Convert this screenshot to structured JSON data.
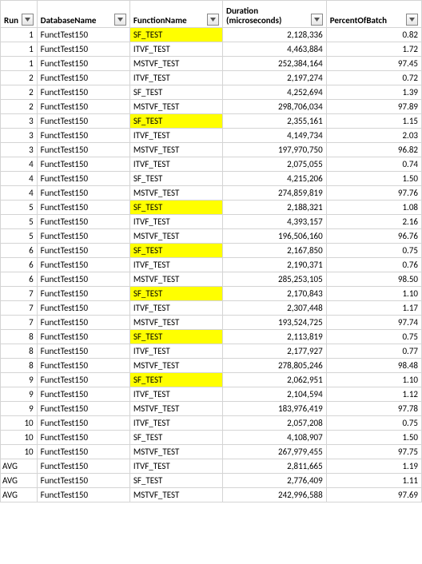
{
  "headers": {
    "run": "Run",
    "db": "DatabaseName",
    "fn": "FunctionName",
    "dur": "Duration (microseconds)",
    "pct": "PercentOfBatch"
  },
  "rows": [
    {
      "run": "1",
      "db": "FunctTest150",
      "fn": "SF_TEST",
      "dur": "2,128,336",
      "pct": "0.82",
      "hl": true
    },
    {
      "run": "1",
      "db": "FunctTest150",
      "fn": "ITVF_TEST",
      "dur": "4,463,884",
      "pct": "1.72",
      "hl": false
    },
    {
      "run": "1",
      "db": "FunctTest150",
      "fn": "MSTVF_TEST",
      "dur": "252,384,164",
      "pct": "97.45",
      "hl": false
    },
    {
      "run": "2",
      "db": "FunctTest150",
      "fn": "ITVF_TEST",
      "dur": "2,197,274",
      "pct": "0.72",
      "hl": false
    },
    {
      "run": "2",
      "db": "FunctTest150",
      "fn": "SF_TEST",
      "dur": "4,252,694",
      "pct": "1.39",
      "hl": false
    },
    {
      "run": "2",
      "db": "FunctTest150",
      "fn": "MSTVF_TEST",
      "dur": "298,706,034",
      "pct": "97.89",
      "hl": false
    },
    {
      "run": "3",
      "db": "FunctTest150",
      "fn": "SF_TEST",
      "dur": "2,355,161",
      "pct": "1.15",
      "hl": true
    },
    {
      "run": "3",
      "db": "FunctTest150",
      "fn": "ITVF_TEST",
      "dur": "4,149,734",
      "pct": "2.03",
      "hl": false
    },
    {
      "run": "3",
      "db": "FunctTest150",
      "fn": "MSTVF_TEST",
      "dur": "197,970,750",
      "pct": "96.82",
      "hl": false
    },
    {
      "run": "4",
      "db": "FunctTest150",
      "fn": "ITVF_TEST",
      "dur": "2,075,055",
      "pct": "0.74",
      "hl": false
    },
    {
      "run": "4",
      "db": "FunctTest150",
      "fn": "SF_TEST",
      "dur": "4,215,206",
      "pct": "1.50",
      "hl": false
    },
    {
      "run": "4",
      "db": "FunctTest150",
      "fn": "MSTVF_TEST",
      "dur": "274,859,819",
      "pct": "97.76",
      "hl": false
    },
    {
      "run": "5",
      "db": "FunctTest150",
      "fn": "SF_TEST",
      "dur": "2,188,321",
      "pct": "1.08",
      "hl": true
    },
    {
      "run": "5",
      "db": "FunctTest150",
      "fn": "ITVF_TEST",
      "dur": "4,393,157",
      "pct": "2.16",
      "hl": false
    },
    {
      "run": "5",
      "db": "FunctTest150",
      "fn": "MSTVF_TEST",
      "dur": "196,506,160",
      "pct": "96.76",
      "hl": false
    },
    {
      "run": "6",
      "db": "FunctTest150",
      "fn": "SF_TEST",
      "dur": "2,167,850",
      "pct": "0.75",
      "hl": true
    },
    {
      "run": "6",
      "db": "FunctTest150",
      "fn": "ITVF_TEST",
      "dur": "2,190,371",
      "pct": "0.76",
      "hl": false
    },
    {
      "run": "6",
      "db": "FunctTest150",
      "fn": "MSTVF_TEST",
      "dur": "285,253,105",
      "pct": "98.50",
      "hl": false
    },
    {
      "run": "7",
      "db": "FunctTest150",
      "fn": "SF_TEST",
      "dur": "2,170,843",
      "pct": "1.10",
      "hl": true
    },
    {
      "run": "7",
      "db": "FunctTest150",
      "fn": "ITVF_TEST",
      "dur": "2,307,448",
      "pct": "1.17",
      "hl": false
    },
    {
      "run": "7",
      "db": "FunctTest150",
      "fn": "MSTVF_TEST",
      "dur": "193,524,725",
      "pct": "97.74",
      "hl": false
    },
    {
      "run": "8",
      "db": "FunctTest150",
      "fn": "SF_TEST",
      "dur": "2,113,819",
      "pct": "0.75",
      "hl": true
    },
    {
      "run": "8",
      "db": "FunctTest150",
      "fn": "ITVF_TEST",
      "dur": "2,177,927",
      "pct": "0.77",
      "hl": false
    },
    {
      "run": "8",
      "db": "FunctTest150",
      "fn": "MSTVF_TEST",
      "dur": "278,805,246",
      "pct": "98.48",
      "hl": false
    },
    {
      "run": "9",
      "db": "FunctTest150",
      "fn": "SF_TEST",
      "dur": "2,062,951",
      "pct": "1.10",
      "hl": true
    },
    {
      "run": "9",
      "db": "FunctTest150",
      "fn": "ITVF_TEST",
      "dur": "2,104,594",
      "pct": "1.12",
      "hl": false
    },
    {
      "run": "9",
      "db": "FunctTest150",
      "fn": "MSTVF_TEST",
      "dur": "183,976,419",
      "pct": "97.78",
      "hl": false
    },
    {
      "run": "10",
      "db": "FunctTest150",
      "fn": "ITVF_TEST",
      "dur": "2,057,208",
      "pct": "0.75",
      "hl": false
    },
    {
      "run": "10",
      "db": "FunctTest150",
      "fn": "SF_TEST",
      "dur": "4,108,907",
      "pct": "1.50",
      "hl": false
    },
    {
      "run": "10",
      "db": "FunctTest150",
      "fn": "MSTVF_TEST",
      "dur": "267,979,455",
      "pct": "97.75",
      "hl": false
    },
    {
      "run": "AVG",
      "db": "FunctTest150",
      "fn": "ITVF_TEST",
      "dur": "2,811,665",
      "pct": "1.19",
      "hl": false,
      "avg": true
    },
    {
      "run": "AVG",
      "db": "FunctTest150",
      "fn": "SF_TEST",
      "dur": "2,776,409",
      "pct": "1.11",
      "hl": false,
      "avg": true
    },
    {
      "run": "AVG",
      "db": "FunctTest150",
      "fn": "MSTVF_TEST",
      "dur": "242,996,588",
      "pct": "97.69",
      "hl": false,
      "avg": true
    }
  ]
}
